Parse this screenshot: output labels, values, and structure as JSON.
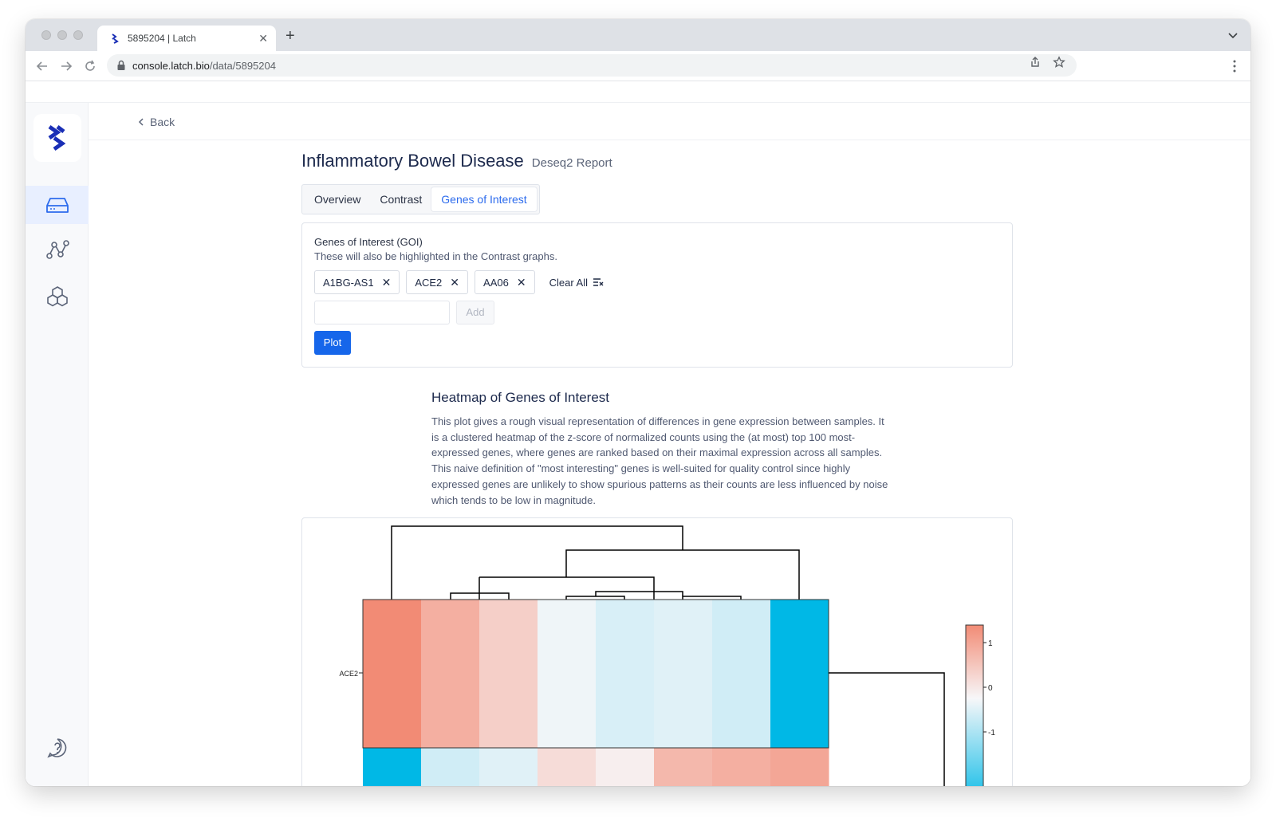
{
  "browser": {
    "tab_title": "5895204 | Latch",
    "tab_close": "✕",
    "new_tab": "+",
    "url_host": "console.latch.bio",
    "url_path": "/data/5895204"
  },
  "page": {
    "back_label": "Back",
    "title": "Inflammatory Bowel Disease",
    "subtitle": "Deseq2 Report",
    "tabs": [
      {
        "label": "Overview",
        "active": false
      },
      {
        "label": "Contrast",
        "active": false
      },
      {
        "label": "Genes of Interest",
        "active": true
      }
    ]
  },
  "goi": {
    "heading": "Genes of Interest (GOI)",
    "description": "These will also be highlighted in the Contrast graphs.",
    "chips": [
      "A1BG-AS1",
      "ACE2",
      "AA06"
    ],
    "chip_remove": "✕",
    "clear_all": "Clear All",
    "input_value": "",
    "add_label": "Add",
    "plot_label": "Plot"
  },
  "heatmap_section": {
    "title": "Heatmap of Genes of Interest",
    "description": "This plot gives a rough visual representation of differences in gene expression between samples. It is a clustered heatmap of the z-score of normalized counts using the (at most) top 100 most-expressed genes, where genes are ranked based on their maximal expression across all samples. This naive definition of \"most interesting\" genes is well-suited for quality control since highly expressed genes are unlikely to show spurious patterns as their counts are less influenced by noise which tends to be low in magnitude."
  },
  "chart_data": {
    "type": "heatmap",
    "row_labels": [
      "ACE2",
      ""
    ],
    "columns": 8,
    "values": [
      [
        1.2,
        0.8,
        0.45,
        -0.05,
        -0.2,
        -0.15,
        -0.25,
        -1.6
      ],
      [
        -1.6,
        -0.25,
        -0.15,
        0.3,
        0.1,
        0.7,
        0.8,
        0.9
      ]
    ],
    "colorbar": {
      "ticks": [
        1,
        0,
        -1
      ],
      "tick_labels": [
        "1",
        "0",
        "-1"
      ]
    },
    "colors": {
      "high": "#f28b75",
      "mid": "#f7f7f9",
      "low": "#00b8e6"
    }
  }
}
